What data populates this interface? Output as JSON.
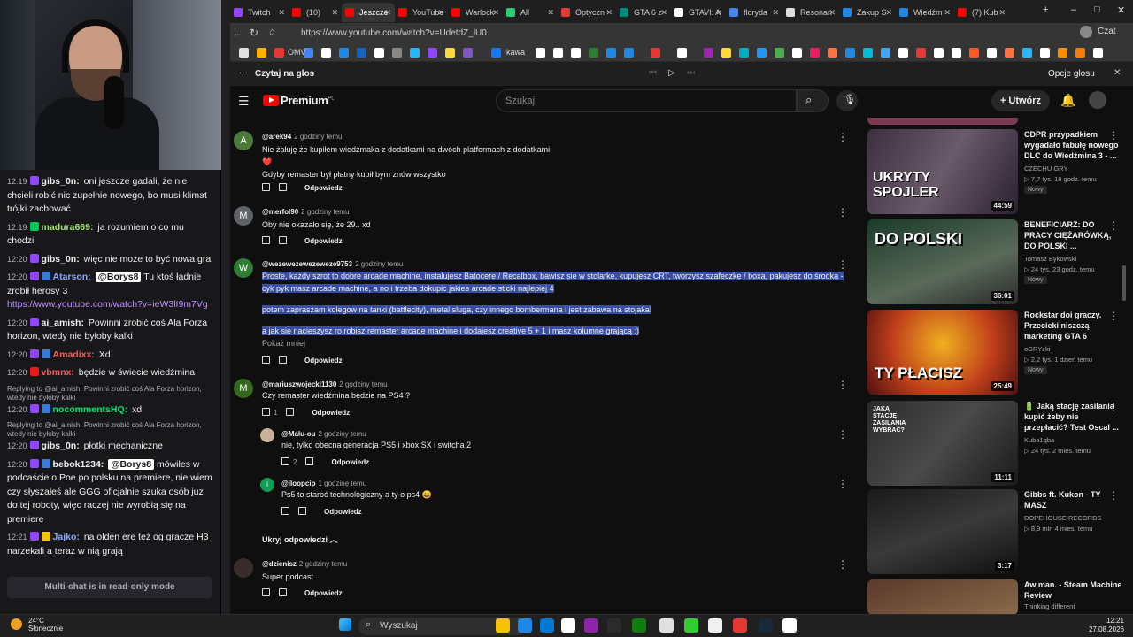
{
  "chat": {
    "messages": [
      {
        "time": "12:19",
        "user": "gibs_0n:",
        "text": "oni jeszcze gadali, że nie chcieli robić nic zupełnie nowego, bo musi klimat trójki zachować",
        "color": "#ffffff"
      },
      {
        "time": "12:19",
        "user": "madura669:",
        "text": "ja rozumiem o co mu chodzi",
        "color": "#a4e36a"
      },
      {
        "time": "12:20",
        "user": "gibs_0n:",
        "text": "więc nie może to być nowa gra",
        "color": "#ffffff"
      },
      {
        "time": "12:20",
        "user": "Atarson:",
        "mention": "@Borys8",
        "text": "Tu ktoś ładnie zrobił herosy 3",
        "link": "https://www.youtube.com/watch?v=ieW3lI9m7Vg",
        "color": "#8aa8ff"
      },
      {
        "time": "12:20",
        "user": "ai_amish:",
        "text": "Powinni zrobić coś Ala Forza horizon, wtedy nie byłoby kalki",
        "color": "#ffffff"
      },
      {
        "time": "12:20",
        "user": "Amadixx:",
        "text": "Xd",
        "color": "#ff5a5a"
      },
      {
        "time": "12:20",
        "user": "vbmnx:",
        "text": "będzie w świecie wiedźmina",
        "color": "#ff5a5a"
      },
      {
        "reply": "Replying to @ai_amish: Powinni zrobić coś Ala Forza horizon, wtedy nie byłoby kalki",
        "time": "12:20",
        "user": "nocommentsHQ:",
        "text": "xd",
        "color": "#00e676"
      },
      {
        "reply": "Replying to @ai_amish: Powinni zrobić coś Ala Forza horizon, wtedy nie byłoby kalki",
        "time": "12:20",
        "user": "gibs_0n:",
        "text": "płotki mechaniczne",
        "color": "#ffffff"
      },
      {
        "time": "12:20",
        "user": "bebok1234:",
        "mention": "@Borys8",
        "text": "mówiłes w podcaście o Poe po polsku na premiere, nie wiem czy słyszałeś ale GGG oficjalnie szuka osób juz do tej roboty, więc raczej nie wyrobią się na premiere",
        "color": "#ffffff"
      },
      {
        "time": "12:21",
        "user": "Jajko:",
        "text": "na olden ere też og gracze H3 narzekali a teraz w nią grają",
        "color": "#8aa8ff"
      }
    ],
    "readonly": "Multi-chat is in read-only mode"
  },
  "browser": {
    "tabs": [
      "Twitch",
      "(10)",
      "Jeszcze",
      "YouTube",
      "Warlock",
      "All",
      "Optyczn",
      "GTA 6 z",
      "GTAVI: A",
      "floryda",
      "Resonan",
      "Zakup S",
      "Wiedźm",
      "(7) Kub"
    ],
    "url": "https://www.youtube.com/watch?v=UdetdZ_lU0",
    "bookmark_label": "kawa",
    "omv": "OMV",
    "tts_title": "Czytaj na głos",
    "tts_options": "Opcje głosu",
    "tab_colors": [
      "#9147ff",
      "#ff0000",
      "#ff0000",
      "#ff0000",
      "#ff0000",
      "#2ecc71",
      "#e53935",
      "#00897b",
      "#ffffff",
      "#4285f4",
      "#dddddd",
      "#1e88e5",
      "#1e88e5",
      "#ff0000"
    ]
  },
  "yt": {
    "logo": "Premium",
    "region": "PL",
    "search_placeholder": "Szukaj",
    "create": "Utwórz",
    "comments": [
      {
        "initial": "A",
        "avatar": "#4a7a3a",
        "user": "@arek94",
        "time": "2 godziny temu",
        "lines": [
          "Nie żałuję że kupiłem wiedźmaka z dodatkami na dwóch platformach z dodatkami",
          "❤️",
          "Gdyby remaster był płatny kupił bym znów wszystko"
        ],
        "reply": "Odpowiedz"
      },
      {
        "initial": "M",
        "avatar": "#5f6368",
        "user": "@merfol90",
        "time": "2 godziny temu",
        "lines": [
          "Oby nie okazało się, że 29.. xd"
        ],
        "reply": "Odpowiedz"
      },
      {
        "initial": "W",
        "avatar": "#2e7d32",
        "user": "@wezewezewezeweze9753",
        "time": "2 godziny temu",
        "lines": [
          "Proste, każdy szrot to dobre arcade machine, instalujesz Batocere / Recalbox, bawisz sie w stolarke, kupujesz CRT, tworzysz szafeczkę / boxa, pakujesz do środka - cyk pyk masz arcade machine, a no i trzeba dokupic jakies arcade sticki najlepiej 4",
          "potem zapraszam kolegow na tanki (battlecity), metal sluga, czy innego bombermana i jest zabawa na stojaka!",
          "a jak sie nacieszysz ro robisz remaster arcade machine i dodajesz creative 5 + 1 i masz kolumne grającą :)"
        ],
        "more": "Pokaż mniej",
        "reply": "Odpowiedz"
      },
      {
        "initial": "M",
        "avatar": "#33691e",
        "user": "@mariuszwojecki1130",
        "time": "2 godziny temu",
        "lines": [
          "Czy remaster wiedźmina będzie na PS4 ?"
        ],
        "likes": "1",
        "reply": "Odpowiedz"
      }
    ],
    "replies": [
      {
        "user": "@Malu-ou",
        "time": "2 godziny temu",
        "text": "nie, tylko obecna generacja PS5 i xbox SX i switcha 2",
        "likes": "2",
        "reply": "Odpowiedz"
      },
      {
        "initial": "i",
        "user": "@iloopcip",
        "time": "1 godzinę temu",
        "text": "Ps5 to staroć technologiczny a ty o ps4 😄",
        "reply": "Odpowiedz"
      }
    ],
    "hide_replies": "Ukryj odpowiedzi",
    "last_comment": {
      "user": "@dzienisz",
      "time": "2 godziny temu",
      "text": "Super podcast",
      "reply": "Odpowiedz"
    },
    "sidebar": [
      {
        "title": "CDPR przypadkiem wygadało fabułę nowego DLC do Wiedźmina 3 - ...",
        "channel": "CZECHU GRY",
        "meta": "▷ 7,7 tys.  18 godz. temu",
        "badge": "Nowy",
        "duration": "44:59",
        "thumb_text": "UKRYTY SPOJLER"
      },
      {
        "title": "BENEFICIARZ: DO PRACY CIĘŻARÓWKĄ, DO POLSKI ...",
        "channel": "Tomasz Bykowski",
        "meta": "▷ 24 tys.  23 godz. temu",
        "badge": "Nowy",
        "duration": "36:01",
        "thumb_text": "DO POLSKI"
      },
      {
        "title": "Rockstar doi graczy. Przecieki niszczą marketing GTA 6",
        "channel": "oGRYzki",
        "meta": "▷ 2,2 tys.  1 dzień temu",
        "badge": "Nowy",
        "duration": "25:49",
        "thumb_text": "TY PŁACISZ"
      },
      {
        "title": "🔋 Jaką stację zasilania kupić żeby nie przepłacić? Test Oscal ...",
        "channel": "Kuba1qba",
        "meta": "▷ 24 tys.  2 mies. temu",
        "duration": "11:11",
        "thumb_text": "JAKĄ STACJĘ ZASILANIA WYBRAĆ?"
      },
      {
        "title": "Gibbs ft. Kukon - TY MASZ",
        "channel": "DOPEHOUSE RECORDS",
        "meta": "▷ 8,9 mln  4 mies. temu",
        "duration": "3:17"
      },
      {
        "title": "Aw man. - Steam Machine Review",
        "channel": "Thinking different"
      }
    ]
  },
  "taskbar": {
    "temp": "24°C",
    "weather": "Słonecznie",
    "search": "Wyszukaj",
    "time": "12:21",
    "date": "27.08.2026"
  }
}
